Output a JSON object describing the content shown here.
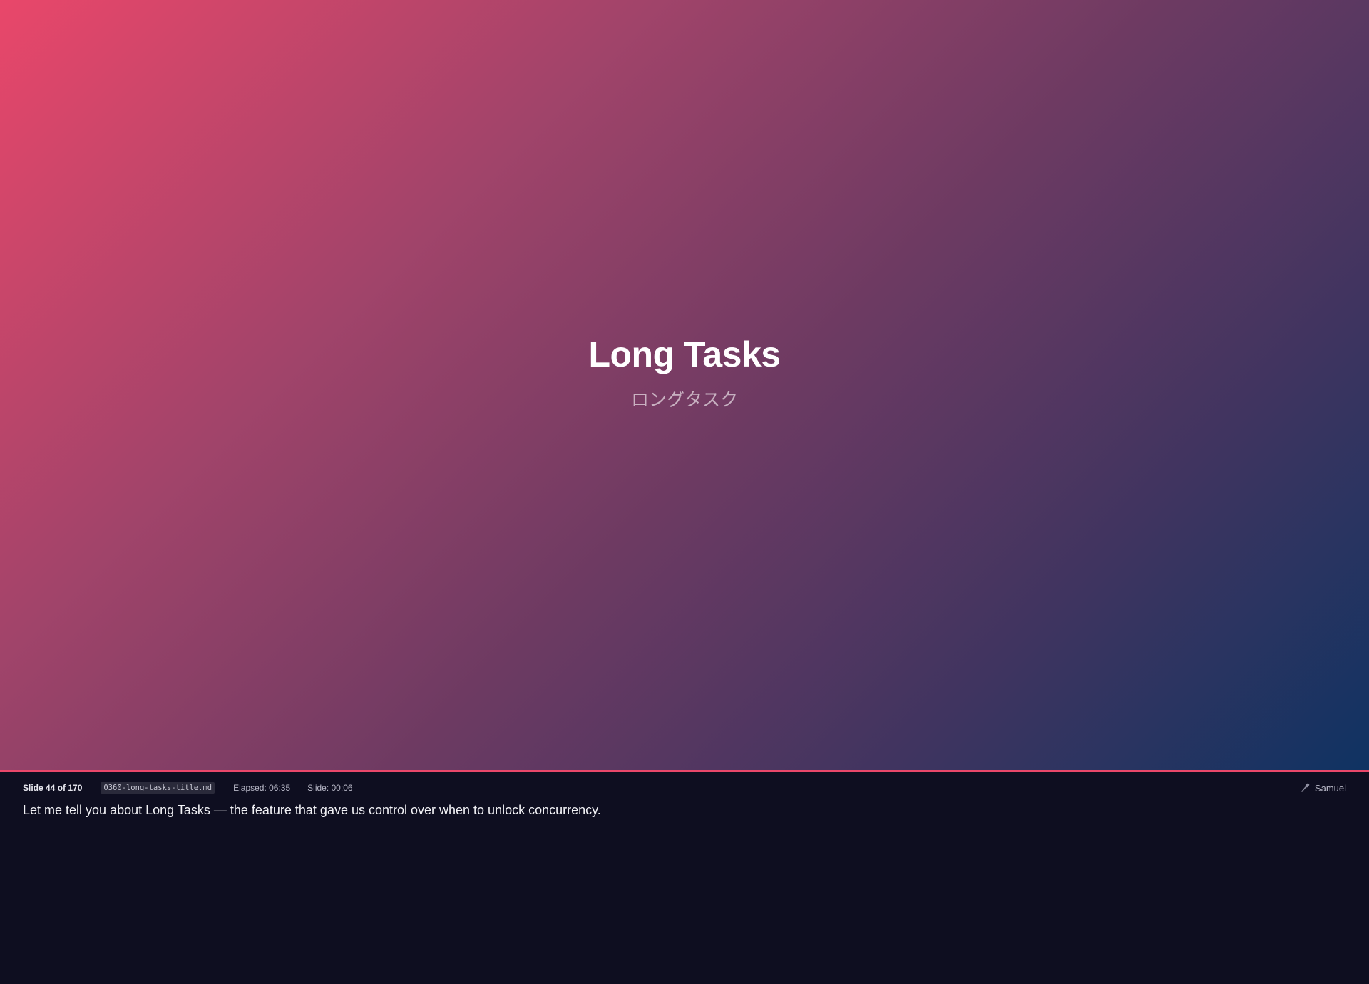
{
  "slide": {
    "title": "Long Tasks",
    "subtitle": "ロングタスク"
  },
  "status": {
    "slide_counter": "Slide 44 of 170",
    "filename": "0360-long-tasks-title.md",
    "elapsed": "Elapsed: 06:35",
    "slide_time": "Slide: 00:06",
    "presenter": "Samuel",
    "presenter_icon": "microphone-icon"
  },
  "notes": {
    "text": "Let me tell you about Long Tasks — the feature that gave us control over when to unlock concurrency."
  },
  "colors": {
    "accent": "#e9476a",
    "panel_bg": "#0e0e20",
    "gradient_start": "#e9476a",
    "gradient_end": "#0f3362"
  }
}
